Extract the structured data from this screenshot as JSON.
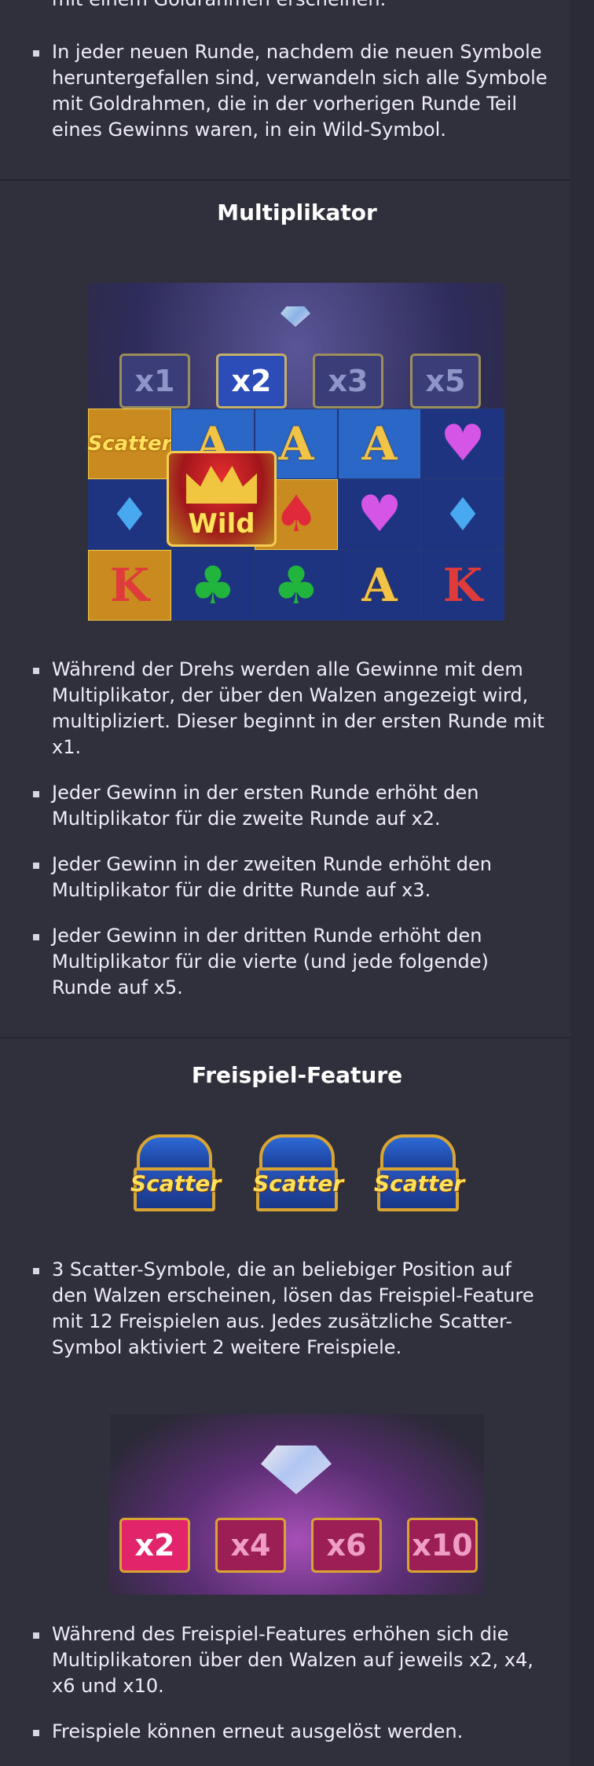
{
  "top_section": {
    "cut_line": "mit einem Goldrahmen erscheinen.",
    "bullets": [
      "In jeder neuen Runde, nachdem die neuen Symbole heruntergefallen sind, verwandeln sich alle Symbole mit Goldrahmen, die in der vorherigen Runde Teil eines Gewinns waren, in ein Wild-Symbol."
    ]
  },
  "multiplier_section": {
    "title": "Multiplikator",
    "image": {
      "multipliers": [
        "x1",
        "x2",
        "x3",
        "x5"
      ],
      "active_multiplier": "x2",
      "scatter_label": "Scatter",
      "wild_label": "Wild",
      "symbols": {
        "a": "A",
        "k": "K"
      }
    },
    "bullets": [
      "Während der Drehs werden alle Gewinne mit dem Multiplikator, der über den Walzen angezeigt wird, multipliziert. Dieser beginnt in der ersten Runde mit x1.",
      "Jeder Gewinn in der ersten Runde erhöht den Multiplikator für die zweite Runde auf x2.",
      "Jeder Gewinn in der zweiten Runde erhöht den Multiplikator für die dritte Runde auf x3.",
      "Jeder Gewinn in der dritten Runde erhöht den Multiplikator für die vierte (und jede folgende) Runde auf x5."
    ]
  },
  "freespin_section": {
    "title": "Freispiel-Feature",
    "scatter_icons": [
      "Scatter",
      "Scatter",
      "Scatter"
    ],
    "bullets_1": [
      "3 Scatter-Symbole, die an beliebiger Position auf den Walzen erscheinen, lösen das Freispiel-Feature mit 12 Freispielen aus. Jedes zusätzliche Scatter-Symbol aktiviert 2 weitere Freispiele."
    ],
    "image": {
      "multipliers": [
        "x2",
        "x4",
        "x6",
        "x10"
      ],
      "active_multiplier": "x2"
    },
    "bullets_2": [
      "Während des Freispiel-Features erhöhen sich die Multiplikatoren über den Walzen auf jeweils x2, x4, x6 und x10.",
      "Freispiele können erneut ausgelöst werden."
    ]
  },
  "colors": {
    "page_bg": "#2b2a37",
    "panel_bg": "#30303d",
    "text": "#efedf5",
    "accent_gold": "#d8a532"
  }
}
